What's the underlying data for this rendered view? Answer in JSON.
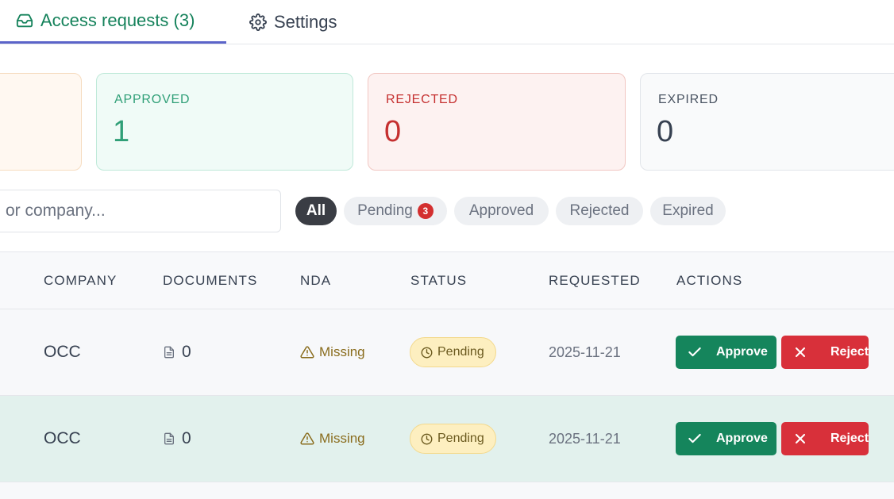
{
  "tabs": {
    "access_requests": "Access requests (3)",
    "settings": "Settings"
  },
  "stats": {
    "approved": {
      "label": "APPROVED",
      "value": "1"
    },
    "rejected": {
      "label": "REJECTED",
      "value": "0"
    },
    "expired": {
      "label": "EXPIRED",
      "value": "0"
    }
  },
  "search": {
    "placeholder": "or company..."
  },
  "filters": {
    "all": "All",
    "pending": "Pending",
    "pending_count": "3",
    "approved": "Approved",
    "rejected": "Rejected",
    "expired": "Expired",
    "active": "All"
  },
  "table": {
    "headers": {
      "company": "COMPANY",
      "documents": "DOCUMENTS",
      "nda": "NDA",
      "status": "STATUS",
      "requested": "REQUESTED",
      "actions": "ACTIONS"
    },
    "rows": [
      {
        "company": "OCC",
        "documents": "0",
        "nda": "Missing",
        "status": "Pending",
        "requested": "2025-11-21",
        "approve": "Approve",
        "reject": "Reject"
      },
      {
        "company": "OCC",
        "documents": "0",
        "nda": "Missing",
        "status": "Pending",
        "requested": "2025-11-21",
        "approve": "Approve",
        "reject": "Reject"
      }
    ]
  },
  "colors": {
    "accent_green": "#15825b",
    "tab_underline": "#5b64c9",
    "approve_button": "#15855c",
    "reject_button": "#d8303a",
    "pending_badge": "#fdefc0"
  },
  "icons": {
    "access_requests_tab": "inbox-icon",
    "settings_tab": "gear-icon",
    "documents": "document-icon",
    "nda": "warning-triangle-icon",
    "status": "clock-icon",
    "approve": "check-icon",
    "reject": "x-icon"
  }
}
